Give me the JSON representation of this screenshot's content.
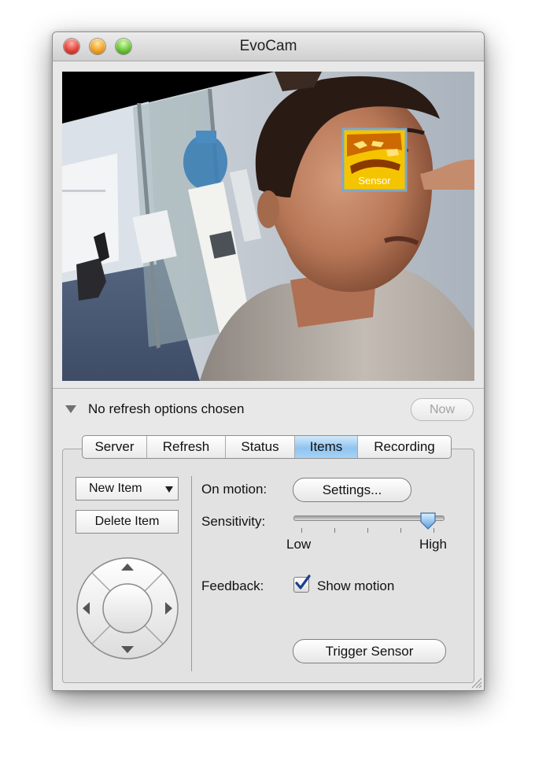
{
  "window": {
    "title": "EvoCam"
  },
  "camera": {
    "motion_region_label": "Sensor"
  },
  "refresh": {
    "status": "No refresh options chosen",
    "now_label": "Now"
  },
  "tabs": [
    {
      "label": "Server"
    },
    {
      "label": "Refresh"
    },
    {
      "label": "Status"
    },
    {
      "label": "Items",
      "active": true
    },
    {
      "label": "Recording"
    }
  ],
  "items": {
    "new_item_label": "New Item",
    "delete_item_label": "Delete Item"
  },
  "motion": {
    "on_motion_label": "On motion:",
    "settings_label": "Settings...",
    "sensitivity_label": "Sensitivity:",
    "sensitivity_low": "Low",
    "sensitivity_high": "High",
    "sensitivity_value": 0.9,
    "feedback_label": "Feedback:",
    "show_motion_label": "Show motion",
    "show_motion_checked": true,
    "trigger_label": "Trigger Sensor"
  },
  "colors": {
    "accent": "#8fc4ef",
    "sensor_fill": "#f5c400"
  }
}
